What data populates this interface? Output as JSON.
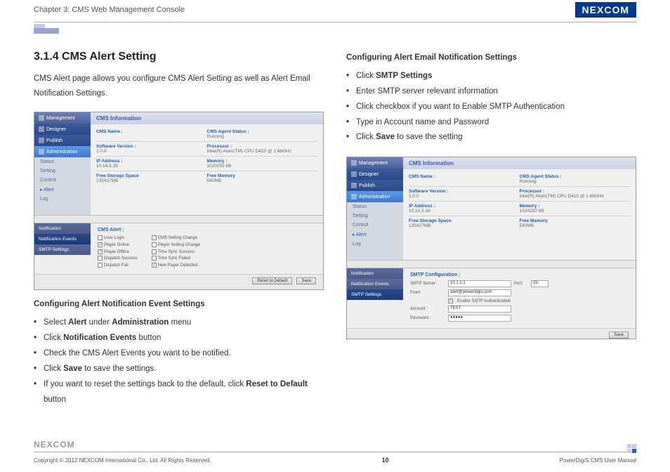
{
  "header": {
    "chapter": "Chapter 3: CMS Web Management Console",
    "brand": "NEXCOM"
  },
  "left": {
    "title": "3.1.4 CMS Alert Setting",
    "intro": "CMS Alert page allows you configure CMS Alert Setting as well as Alert Email Notification Settings.",
    "subhead": "Configuring Alert Notification Event Settings",
    "steps": {
      "s1a": "Select ",
      "s1b": "Alert",
      "s1c": " under ",
      "s1d": "Administration",
      "s1e": " menu",
      "s2a": "Click ",
      "s2b": "Notification Events",
      "s2c": " button",
      "s3": "Check the CMS Alert Events you want to be notified.",
      "s4a": "Click ",
      "s4b": "Save",
      "s4c": " to save the settings.",
      "s5a": "If you want to reset the settings back to the default, click ",
      "s5b": "Reset to Default",
      "s5c": " button"
    }
  },
  "right": {
    "subhead": "Configuring Alert Email Notification Settings",
    "steps": {
      "s1a": "Click ",
      "s1b": "SMTP Settings",
      "s2": "Enter SMTP server relevant information",
      "s3": "Click checkbox if you want to Enable SMTP Authentication",
      "s4": "Type in Account name and Password",
      "s5a": "Click ",
      "s5b": "Save",
      "s5c": " to save the setting"
    }
  },
  "ss": {
    "sidebar": {
      "mgmt": "Management",
      "des": "Designer",
      "pub": "Publish",
      "admin": "Administration",
      "status": "Status",
      "setting": "Setting",
      "control": "Control",
      "alert": "▸ Alert",
      "log": "Log"
    },
    "title": "CMS Information",
    "info": {
      "name_l": "CMS Name :",
      "name_v": "",
      "agent_l": "CMS Agent Status :",
      "agent_v": "Running",
      "ver_l": "Software Version :",
      "ver_v": "1.0.0",
      "proc_l": "Processor :",
      "proc_v": "Intel(R) Atom(TM) CPU D410 @ 1.66GHz",
      "ip_l": "IP Address :",
      "ip_v": "10.14.5.39",
      "mem_l": "Memory :",
      "mem_v": "1020252 kB",
      "stor_l": "Free Storage Space",
      "stor_v": "135427MB",
      "fmem_l": "Free Memory",
      "fmem_v": "540MB"
    },
    "tabs": {
      "n": "Notification",
      "ne": "Notification Events",
      "s": "SMTP Settings"
    },
    "alert": {
      "hdr": "CMS Alert :",
      "c1a": "User Login",
      "c1b": "Player Online",
      "c1c": "Player Offline",
      "c1d": "Dispatch Success",
      "c1e": "Dispatch Fail",
      "c2a": "CMS Setting Change",
      "c2b": "Player Setting Change",
      "c2c": "Time Sync Success",
      "c2d": "Time Sync Failed",
      "c2e": "New Player Detected"
    },
    "btn": {
      "reset": "Reset to Default",
      "save": "Save"
    },
    "smtp": {
      "hdr": "SMTP Configuration :",
      "server_l": "SMTP Server:",
      "server_v": "10.1.1.1",
      "port_l": "Port:",
      "port_v": "25",
      "from_l": "From:",
      "from_v": "alert@powerdigis.com",
      "enable": "Enable SMTP Authentication",
      "acct_l": "Account :",
      "acct_v": "TEST",
      "pwd_l": "Password :",
      "pwd_v": "●●●●●"
    }
  },
  "footer": {
    "copyright": "Copyright © 2012 NEXCOM International Co., Ltd. All Rights Reserved.",
    "page": "10",
    "manual": "PowerDigiS CMS User Manual",
    "brand": "NEXCOM"
  }
}
